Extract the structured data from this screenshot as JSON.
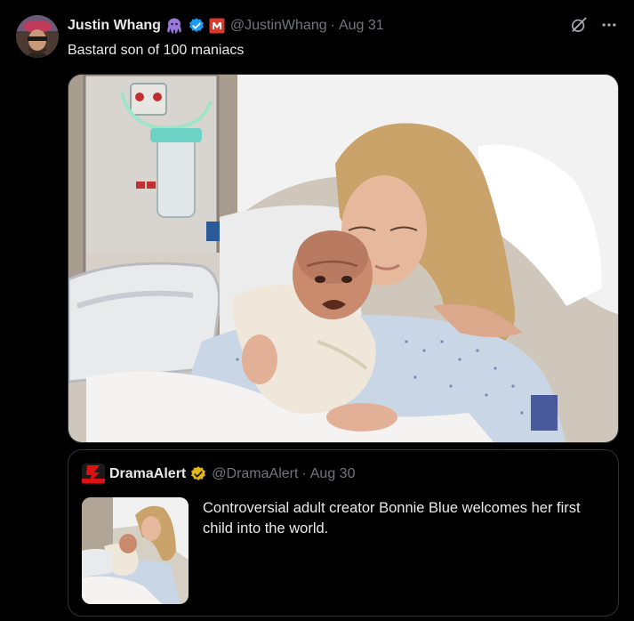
{
  "tweet": {
    "display_name": "Justin Whang",
    "handle": "@JustinWhang",
    "separator": "·",
    "date": "Aug 31",
    "text": "Bastard son of 100 maniacs",
    "icons": {
      "octopus": "octopus-icon",
      "verified": "verified-badge-icon",
      "affiliate": "affiliate-badge-icon",
      "grok": "grok-icon",
      "more": "more-icon"
    }
  },
  "quote": {
    "display_name": "DramaAlert",
    "handle": "@DramaAlert",
    "separator": "·",
    "date": "Aug 30",
    "text": "Controversial adult creator Bonnie Blue welcomes her first child into the world.",
    "avatar_label": "DramaAlert"
  },
  "colors": {
    "background": "#000000",
    "text_primary": "#e7e9ea",
    "text_secondary": "#71767b",
    "border": "#2f3336",
    "verified_blue": "#1d9bf0",
    "verified_gold": "#e2b719",
    "octopus_purple": "#9b79d9",
    "affiliate_red": "#d93a2b"
  }
}
